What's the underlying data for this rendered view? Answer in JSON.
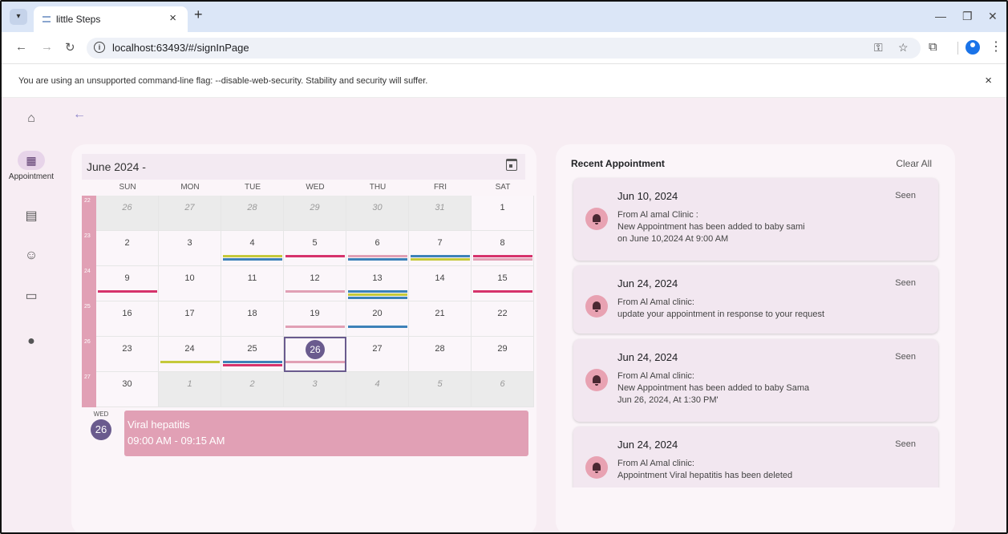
{
  "browser": {
    "tab_title": "little Steps",
    "tab_close": "×",
    "new_tab": "+",
    "url": "localhost:63493/#/signInPage",
    "warning": "You are using an unsupported command-line flag: --disable-web-security. Stability and security will suffer.",
    "warning_close": "×"
  },
  "rail": {
    "items": [
      {
        "icon": "home-icon",
        "label": ""
      },
      {
        "icon": "calendar-icon",
        "label": "Appointment"
      },
      {
        "icon": "document-icon",
        "label": ""
      },
      {
        "icon": "baby-face-icon",
        "label": ""
      },
      {
        "icon": "chat-icon",
        "label": ""
      },
      {
        "icon": "person-icon",
        "label": ""
      }
    ]
  },
  "calendar": {
    "month_label": "June 2024 -",
    "days_of_week": [
      "SUN",
      "MON",
      "TUE",
      "WED",
      "THU",
      "FRI",
      "SAT"
    ],
    "week_numbers": [
      "22",
      "23",
      "24",
      "25",
      "26",
      "27"
    ],
    "weeks": [
      [
        "26",
        "27",
        "28",
        "29",
        "30",
        "31",
        "1"
      ],
      [
        "2",
        "3",
        "4",
        "5",
        "6",
        "7",
        "8"
      ],
      [
        "9",
        "10",
        "11",
        "12",
        "13",
        "14",
        "15"
      ],
      [
        "16",
        "17",
        "18",
        "19",
        "20",
        "21",
        "22"
      ],
      [
        "23",
        "24",
        "25",
        "26",
        "27",
        "28",
        "29"
      ],
      [
        "30",
        "1",
        "2",
        "3",
        "4",
        "5",
        "6"
      ]
    ],
    "selected_day": {
      "dow": "WED",
      "num": "26"
    },
    "selected_event": {
      "title": "Viral hepatitis",
      "time": "09:00 AM - 09:15 AM"
    },
    "colors": {
      "accent": "#6a5b8e",
      "pink": "#e1a0b5",
      "red": "#d6336c",
      "olive": "#c5c93a",
      "blue": "#3d82b8"
    }
  },
  "recent": {
    "title": "Recent Appointment",
    "clear_all": "Clear All",
    "items": [
      {
        "date": "Jun 10, 2024",
        "seen": "Seen",
        "lines": [
          "From Al amal Clinic :",
          " New Appointment has been added to baby sami",
          " on June 10,2024 At 9:00 AM"
        ]
      },
      {
        "date": "Jun 24, 2024",
        "seen": "Seen",
        "lines": [
          "From Al Amal clinic:",
          " update your appointment in response to your request"
        ]
      },
      {
        "date": "Jun 24, 2024",
        "seen": "Seen",
        "lines": [
          "From Al Amal clinic:",
          " New Appointment has been added to baby Sama",
          " Jun 26, 2024,  At 1:30 PM'"
        ]
      },
      {
        "date": "Jun 24, 2024",
        "seen": "Seen",
        "lines": [
          "From Al Amal clinic:",
          " Appointment Viral hepatitis has been deleted"
        ]
      }
    ]
  }
}
